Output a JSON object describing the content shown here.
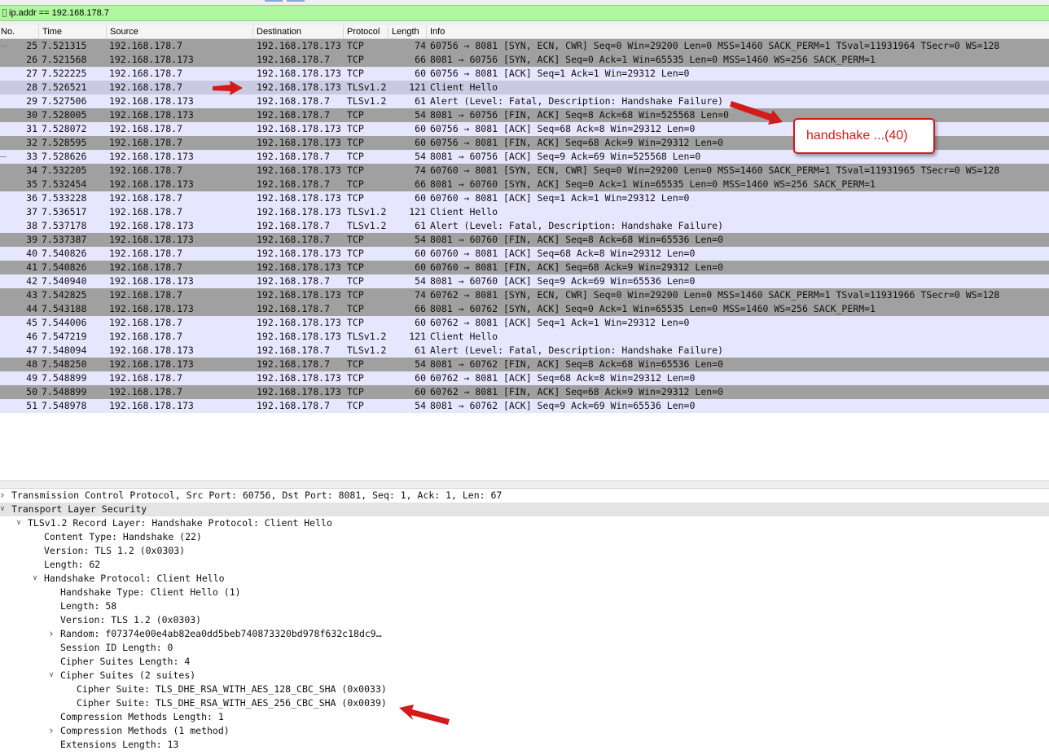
{
  "filter": {
    "value": "ip.addr == 192.168.178.7"
  },
  "columns": {
    "no": "No.",
    "time": "Time",
    "source": "Source",
    "destination": "Destination",
    "protocol": "Protocol",
    "length": "Length",
    "info": "Info"
  },
  "packets": [
    {
      "no": "25",
      "time": "7.521315",
      "src": "192.168.178.7",
      "dst": "192.168.178.173",
      "proto": "TCP",
      "len": "74",
      "info": "60756 → 8081 [SYN, ECN, CWR] Seq=0 Win=29200 Len=0 MSS=1460 SACK_PERM=1 TSval=11931964 TSecr=0 WS=128",
      "style": "dark",
      "rel": true
    },
    {
      "no": "26",
      "time": "7.521568",
      "src": "192.168.178.173",
      "dst": "192.168.178.7",
      "proto": "TCP",
      "len": "66",
      "info": "8081 → 60756 [SYN, ACK] Seq=0 Ack=1 Win=65535 Len=0 MSS=1460 WS=256 SACK_PERM=1",
      "style": "dark",
      "rel": false
    },
    {
      "no": "27",
      "time": "7.522225",
      "src": "192.168.178.7",
      "dst": "192.168.178.173",
      "proto": "TCP",
      "len": "60",
      "info": "60756 → 8081 [ACK] Seq=1 Ack=1 Win=29312 Len=0",
      "style": "tcp",
      "rel": false
    },
    {
      "no": "28",
      "time": "7.526521",
      "src": "192.168.178.7",
      "dst": "192.168.178.173",
      "proto": "TLSv1.2",
      "len": "121",
      "info": "Client Hello",
      "style": "sel",
      "rel": false
    },
    {
      "no": "29",
      "time": "7.527506",
      "src": "192.168.178.173",
      "dst": "192.168.178.7",
      "proto": "TLSv1.2",
      "len": "61",
      "info": "Alert (Level: Fatal, Description: Handshake Failure)",
      "style": "tcp",
      "rel": false
    },
    {
      "no": "30",
      "time": "7.528005",
      "src": "192.168.178.173",
      "dst": "192.168.178.7",
      "proto": "TCP",
      "len": "54",
      "info": "8081 → 60756 [FIN, ACK] Seq=8 Ack=68 Win=525568 Len=0",
      "style": "dark",
      "rel": false
    },
    {
      "no": "31",
      "time": "7.528072",
      "src": "192.168.178.7",
      "dst": "192.168.178.173",
      "proto": "TCP",
      "len": "60",
      "info": "60756 → 8081 [ACK] Seq=68 Ack=8 Win=29312 Len=0",
      "style": "tcp",
      "rel": false
    },
    {
      "no": "32",
      "time": "7.528595",
      "src": "192.168.178.7",
      "dst": "192.168.178.173",
      "proto": "TCP",
      "len": "60",
      "info": "60756 → 8081 [FIN, ACK] Seq=68 Ack=9 Win=29312 Len=0",
      "style": "dark",
      "rel": false
    },
    {
      "no": "33",
      "time": "7.528626",
      "src": "192.168.178.173",
      "dst": "192.168.178.7",
      "proto": "TCP",
      "len": "54",
      "info": "8081 → 60756 [ACK] Seq=9 Ack=69 Win=525568 Len=0",
      "style": "tcp",
      "rel": true
    },
    {
      "no": "34",
      "time": "7.532205",
      "src": "192.168.178.7",
      "dst": "192.168.178.173",
      "proto": "TCP",
      "len": "74",
      "info": "60760 → 8081 [SYN, ECN, CWR] Seq=0 Win=29200 Len=0 MSS=1460 SACK_PERM=1 TSval=11931965 TSecr=0 WS=128",
      "style": "dark",
      "rel": false
    },
    {
      "no": "35",
      "time": "7.532454",
      "src": "192.168.178.173",
      "dst": "192.168.178.7",
      "proto": "TCP",
      "len": "66",
      "info": "8081 → 60760 [SYN, ACK] Seq=0 Ack=1 Win=65535 Len=0 MSS=1460 WS=256 SACK_PERM=1",
      "style": "dark",
      "rel": false
    },
    {
      "no": "36",
      "time": "7.533228",
      "src": "192.168.178.7",
      "dst": "192.168.178.173",
      "proto": "TCP",
      "len": "60",
      "info": "60760 → 8081 [ACK] Seq=1 Ack=1 Win=29312 Len=0",
      "style": "tcp",
      "rel": false
    },
    {
      "no": "37",
      "time": "7.536517",
      "src": "192.168.178.7",
      "dst": "192.168.178.173",
      "proto": "TLSv1.2",
      "len": "121",
      "info": "Client Hello",
      "style": "tcp",
      "rel": false
    },
    {
      "no": "38",
      "time": "7.537178",
      "src": "192.168.178.173",
      "dst": "192.168.178.7",
      "proto": "TLSv1.2",
      "len": "61",
      "info": "Alert (Level: Fatal, Description: Handshake Failure)",
      "style": "tcp",
      "rel": false
    },
    {
      "no": "39",
      "time": "7.537387",
      "src": "192.168.178.173",
      "dst": "192.168.178.7",
      "proto": "TCP",
      "len": "54",
      "info": "8081 → 60760 [FIN, ACK] Seq=8 Ack=68 Win=65536 Len=0",
      "style": "dark",
      "rel": false
    },
    {
      "no": "40",
      "time": "7.540826",
      "src": "192.168.178.7",
      "dst": "192.168.178.173",
      "proto": "TCP",
      "len": "60",
      "info": "60760 → 8081 [ACK] Seq=68 Ack=8 Win=29312 Len=0",
      "style": "tcp",
      "rel": false
    },
    {
      "no": "41",
      "time": "7.540826",
      "src": "192.168.178.7",
      "dst": "192.168.178.173",
      "proto": "TCP",
      "len": "60",
      "info": "60760 → 8081 [FIN, ACK] Seq=68 Ack=9 Win=29312 Len=0",
      "style": "dark",
      "rel": false
    },
    {
      "no": "42",
      "time": "7.540940",
      "src": "192.168.178.173",
      "dst": "192.168.178.7",
      "proto": "TCP",
      "len": "54",
      "info": "8081 → 60760 [ACK] Seq=9 Ack=69 Win=65536 Len=0",
      "style": "tcp",
      "rel": false
    },
    {
      "no": "43",
      "time": "7.542825",
      "src": "192.168.178.7",
      "dst": "192.168.178.173",
      "proto": "TCP",
      "len": "74",
      "info": "60762 → 8081 [SYN, ECN, CWR] Seq=0 Win=29200 Len=0 MSS=1460 SACK_PERM=1 TSval=11931966 TSecr=0 WS=128",
      "style": "dark",
      "rel": false
    },
    {
      "no": "44",
      "time": "7.543188",
      "src": "192.168.178.173",
      "dst": "192.168.178.7",
      "proto": "TCP",
      "len": "66",
      "info": "8081 → 60762 [SYN, ACK] Seq=0 Ack=1 Win=65535 Len=0 MSS=1460 WS=256 SACK_PERM=1",
      "style": "dark",
      "rel": false
    },
    {
      "no": "45",
      "time": "7.544006",
      "src": "192.168.178.7",
      "dst": "192.168.178.173",
      "proto": "TCP",
      "len": "60",
      "info": "60762 → 8081 [ACK] Seq=1 Ack=1 Win=29312 Len=0",
      "style": "tcp",
      "rel": false
    },
    {
      "no": "46",
      "time": "7.547219",
      "src": "192.168.178.7",
      "dst": "192.168.178.173",
      "proto": "TLSv1.2",
      "len": "121",
      "info": "Client Hello",
      "style": "tcp",
      "rel": false
    },
    {
      "no": "47",
      "time": "7.548094",
      "src": "192.168.178.173",
      "dst": "192.168.178.7",
      "proto": "TLSv1.2",
      "len": "61",
      "info": "Alert (Level: Fatal, Description: Handshake Failure)",
      "style": "tcp",
      "rel": false
    },
    {
      "no": "48",
      "time": "7.548250",
      "src": "192.168.178.173",
      "dst": "192.168.178.7",
      "proto": "TCP",
      "len": "54",
      "info": "8081 → 60762 [FIN, ACK] Seq=8 Ack=68 Win=65536 Len=0",
      "style": "dark",
      "rel": false
    },
    {
      "no": "49",
      "time": "7.548899",
      "src": "192.168.178.7",
      "dst": "192.168.178.173",
      "proto": "TCP",
      "len": "60",
      "info": "60762 → 8081 [ACK] Seq=68 Ack=8 Win=29312 Len=0",
      "style": "tcp",
      "rel": false
    },
    {
      "no": "50",
      "time": "7.548899",
      "src": "192.168.178.7",
      "dst": "192.168.178.173",
      "proto": "TCP",
      "len": "60",
      "info": "60762 → 8081 [FIN, ACK] Seq=68 Ack=9 Win=29312 Len=0",
      "style": "dark",
      "rel": false
    },
    {
      "no": "51",
      "time": "7.548978",
      "src": "192.168.178.173",
      "dst": "192.168.178.7",
      "proto": "TCP",
      "len": "54",
      "info": "8081 → 60762 [ACK] Seq=9 Ack=69 Win=65536 Len=0",
      "style": "tcp",
      "rel": false
    }
  ],
  "details": [
    {
      "indent": 0,
      "toggle": "collapsed",
      "text": "Transmission Control Protocol, Src Port: 60756, Dst Port: 8081, Seq: 1, Ack: 1, Len: 67",
      "hl": false
    },
    {
      "indent": 0,
      "toggle": "expanded",
      "text": "Transport Layer Security",
      "hl": true
    },
    {
      "indent": 1,
      "toggle": "expanded",
      "text": "TLSv1.2 Record Layer: Handshake Protocol: Client Hello",
      "hl": false
    },
    {
      "indent": 2,
      "toggle": "none",
      "text": "Content Type: Handshake (22)",
      "hl": false
    },
    {
      "indent": 2,
      "toggle": "none",
      "text": "Version: TLS 1.2 (0x0303)",
      "hl": false
    },
    {
      "indent": 2,
      "toggle": "none",
      "text": "Length: 62",
      "hl": false
    },
    {
      "indent": 2,
      "toggle": "expanded",
      "text": "Handshake Protocol: Client Hello",
      "hl": false
    },
    {
      "indent": 3,
      "toggle": "none",
      "text": "Handshake Type: Client Hello (1)",
      "hl": false
    },
    {
      "indent": 3,
      "toggle": "none",
      "text": "Length: 58",
      "hl": false
    },
    {
      "indent": 3,
      "toggle": "none",
      "text": "Version: TLS 1.2 (0x0303)",
      "hl": false
    },
    {
      "indent": 3,
      "toggle": "collapsed",
      "text": "Random: f07374e00e4ab82ea0dd5beb740873320bd978f632c18dc9…",
      "hl": false
    },
    {
      "indent": 3,
      "toggle": "none",
      "text": "Session ID Length: 0",
      "hl": false
    },
    {
      "indent": 3,
      "toggle": "none",
      "text": "Cipher Suites Length: 4",
      "hl": false
    },
    {
      "indent": 3,
      "toggle": "expanded",
      "text": "Cipher Suites (2 suites)",
      "hl": false
    },
    {
      "indent": 4,
      "toggle": "none",
      "text": "Cipher Suite: TLS_DHE_RSA_WITH_AES_128_CBC_SHA (0x0033)",
      "hl": false
    },
    {
      "indent": 4,
      "toggle": "none",
      "text": "Cipher Suite: TLS_DHE_RSA_WITH_AES_256_CBC_SHA (0x0039)",
      "hl": false
    },
    {
      "indent": 3,
      "toggle": "none",
      "text": "Compression Methods Length: 1",
      "hl": false
    },
    {
      "indent": 3,
      "toggle": "collapsed",
      "text": "Compression Methods (1 method)",
      "hl": false
    },
    {
      "indent": 3,
      "toggle": "none",
      "text": "Extensions Length: 13",
      "hl": false
    }
  ],
  "annotation": {
    "callout_text": "handshake ...(40)",
    "color": "#d21b1b"
  },
  "colors": {
    "tcp_row": "#e7e6ff",
    "dark_row": "#a0a0a0",
    "selected_row": "#c9c9e2",
    "filter_bg": "#b0f5a0"
  }
}
